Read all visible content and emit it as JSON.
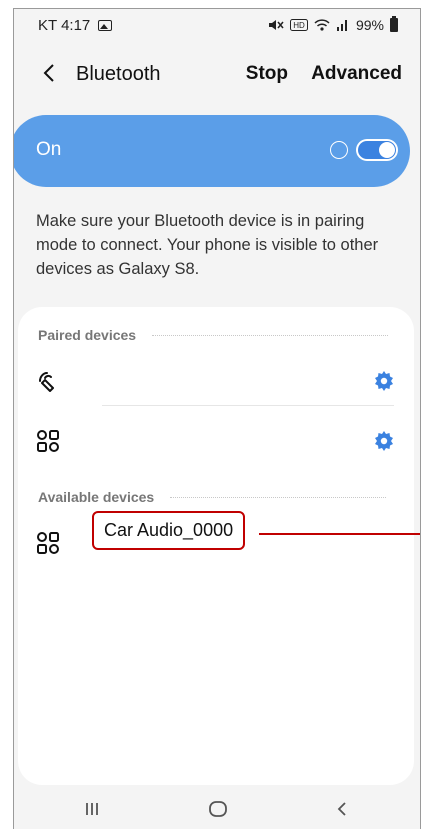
{
  "status_bar": {
    "carrier_time": "KT 4:17",
    "signal_text": "✕🅷 ☔.ıl",
    "battery_percent": "99%",
    "icons": [
      "gallery-icon",
      "mute-icon",
      "wifi-icon",
      "signal-icon",
      "battery-icon"
    ]
  },
  "header": {
    "title": "Bluetooth",
    "stop_label": "Stop",
    "advanced_label": "Advanced"
  },
  "toggle": {
    "label": "On",
    "state": true,
    "accent_color": "#5b9ee8"
  },
  "info_text": "Make sure your Bluetooth device is in pairing mode to connect. Your phone is visible to other devices as Galaxy S8.",
  "paired": {
    "header": "Paired devices",
    "devices": [
      {
        "icon": "headset-icon",
        "name": ""
      },
      {
        "icon": "device-grid-icon",
        "name": ""
      }
    ]
  },
  "available": {
    "header": "Available devices",
    "devices": [
      {
        "icon": "device-grid-icon",
        "name": "Car Audio_0000"
      }
    ]
  },
  "highlight_color": "#c00000",
  "nav": {
    "icons": [
      "recents-icon",
      "home-icon",
      "back-nav-icon"
    ]
  }
}
